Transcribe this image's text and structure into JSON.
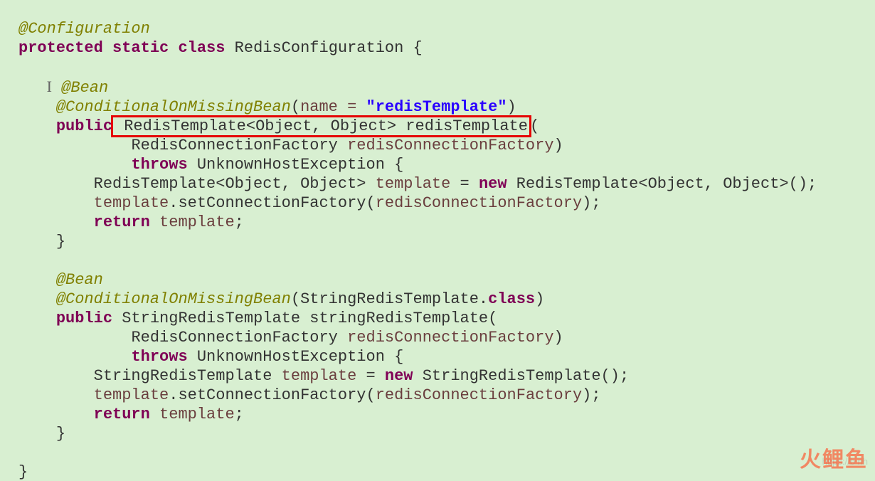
{
  "line1": {
    "annConfiguration": "@Configuration"
  },
  "line2": {
    "kwProtected": "protected",
    "kwStatic": "static",
    "kwClass": "class",
    "className": "RedisConfiguration",
    "brace": " {"
  },
  "line4": {
    "annBean": "@Bean"
  },
  "line5": {
    "annCond": "@ConditionalOnMissingBean",
    "lp": "(",
    "argName": "name = ",
    "strVal": "\"redisTemplate\"",
    "rp": ")"
  },
  "line6": {
    "kwPublic": "public",
    "boxedSig": " RedisTemplate<Object, Object> redisTemplate",
    "lp": "("
  },
  "line7": {
    "paramType": "RedisConnectionFactory ",
    "paramName": "redisConnectionFactory",
    "rp": ")"
  },
  "line8": {
    "kwThrows": "throws",
    "excType": " UnknownHostException {"
  },
  "line9": {
    "declType": "RedisTemplate<Object, Object> ",
    "varName": "template",
    "eq": " = ",
    "kwNew": "new",
    "ctor": " RedisTemplate<Object, Object>();"
  },
  "line10": {
    "varName": "template",
    "call": ".setConnectionFactory(",
    "arg": "redisConnectionFactory",
    "end": ");"
  },
  "line11": {
    "kwReturn": "return",
    "sp": " ",
    "varName": "template",
    "semi": ";"
  },
  "line12": {
    "brace": "}"
  },
  "line14": {
    "annBean": "@Bean"
  },
  "line15": {
    "annCond": "@ConditionalOnMissingBean",
    "lp": "(",
    "argType": "StringRedisTemplate.",
    "kwClass": "class",
    "rp": ")"
  },
  "line16": {
    "kwPublic": "public",
    "retType": " StringRedisTemplate stringRedisTemplate("
  },
  "line17": {
    "paramType": "RedisConnectionFactory ",
    "paramName": "redisConnectionFactory",
    "rp": ")"
  },
  "line18": {
    "kwThrows": "throws",
    "excType": " UnknownHostException {"
  },
  "line19": {
    "declType": "StringRedisTemplate ",
    "varName": "template",
    "eq": " = ",
    "kwNew": "new",
    "ctor": " StringRedisTemplate();"
  },
  "line20": {
    "varName": "template",
    "call": ".setConnectionFactory(",
    "arg": "redisConnectionFactory",
    "end": ");"
  },
  "line21": {
    "kwReturn": "return",
    "sp": " ",
    "varName": "template",
    "semi": ";"
  },
  "line22": {
    "brace": "}"
  },
  "line24": {
    "brace": "}"
  },
  "watermark": "火鲤鱼",
  "faded_url": "https://b                 nh"
}
